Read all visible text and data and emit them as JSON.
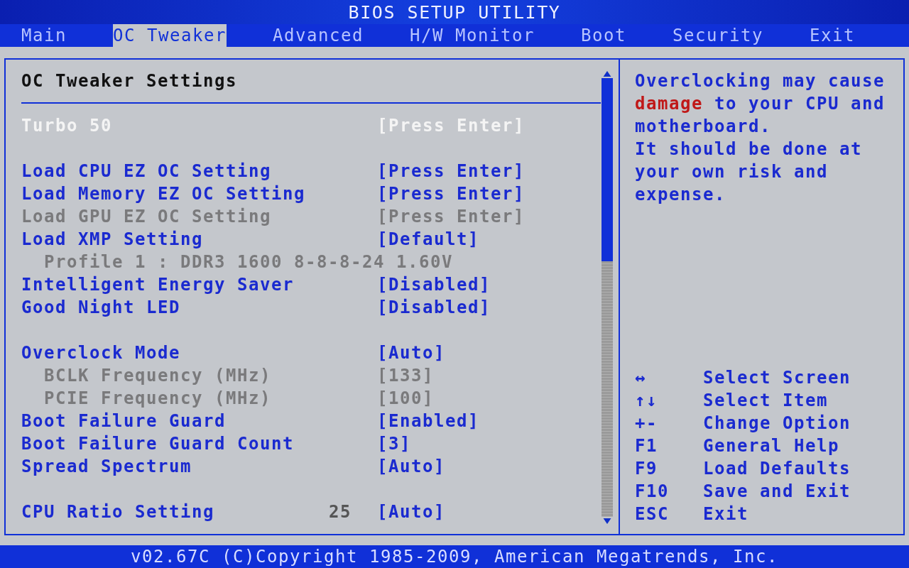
{
  "window": {
    "title": "BIOS SETUP UTILITY"
  },
  "tabs": [
    {
      "label": "Main",
      "selected": false
    },
    {
      "label": "OC Tweaker",
      "selected": true
    },
    {
      "label": "Advanced",
      "selected": false
    },
    {
      "label": "H/W Monitor",
      "selected": false
    },
    {
      "label": "Boot",
      "selected": false
    },
    {
      "label": "Security",
      "selected": false
    },
    {
      "label": "Exit",
      "selected": false
    }
  ],
  "panel_title": "OC Tweaker Settings",
  "item_groups": [
    [
      {
        "label": "Turbo 50",
        "value": "[Press Enter]",
        "selected": true,
        "disabled": false,
        "indented": false
      }
    ],
    [
      {
        "label": "Load CPU EZ OC Setting",
        "value": "[Press Enter]",
        "selected": false,
        "disabled": false,
        "indented": false
      },
      {
        "label": "Load Memory EZ OC Setting",
        "value": "[Press Enter]",
        "selected": false,
        "disabled": false,
        "indented": false
      },
      {
        "label": "Load GPU EZ OC Setting",
        "value": "[Press Enter]",
        "selected": false,
        "disabled": true,
        "indented": false
      },
      {
        "label": "Load XMP Setting",
        "value": "[Default]",
        "selected": false,
        "disabled": false,
        "indented": false
      },
      {
        "label": "Profile 1 : DDR3 1600 8-8-8-24 1.60V",
        "selected": false,
        "disabled": true,
        "indented": true
      },
      {
        "label": "Intelligent Energy Saver",
        "value": "[Disabled]",
        "selected": false,
        "disabled": false,
        "indented": false
      },
      {
        "label": "Good Night LED",
        "value": "[Disabled]",
        "selected": false,
        "disabled": false,
        "indented": false
      }
    ],
    [
      {
        "label": "Overclock Mode",
        "value": "[Auto]",
        "selected": false,
        "disabled": false,
        "indented": false
      },
      {
        "label": "BCLK Frequency (MHz)",
        "value": "[133]",
        "selected": false,
        "disabled": true,
        "indented": true
      },
      {
        "label": "PCIE Frequency (MHz)",
        "value": "[100]",
        "selected": false,
        "disabled": true,
        "indented": true
      },
      {
        "label": "Boot Failure Guard",
        "value": "[Enabled]",
        "selected": false,
        "disabled": false,
        "indented": false
      },
      {
        "label": "Boot Failure Guard Count",
        "value": "[3]",
        "selected": false,
        "disabled": false,
        "indented": false
      },
      {
        "label": "Spread Spectrum",
        "value": "[Auto]",
        "selected": false,
        "disabled": false,
        "indented": false
      }
    ],
    [
      {
        "label": "CPU Ratio Setting",
        "reading": "25",
        "value": "[Auto]",
        "selected": false,
        "disabled": false,
        "indented": false
      }
    ]
  ],
  "help": [
    [
      {
        "text": "Overclocking may cause ",
        "warning": false
      },
      {
        "text": "damage",
        "warning": true
      },
      {
        "text": " to your CPU and motherboard.",
        "warning": false
      }
    ],
    [
      {
        "text": "It should be done at your own risk and expense.",
        "warning": false
      }
    ]
  ],
  "legend": [
    {
      "key": "↔",
      "action": "Select Screen"
    },
    {
      "key": "↑↓",
      "action": "Select Item"
    },
    {
      "key": "+-",
      "action": "Change Option"
    },
    {
      "key": "F1",
      "action": "General Help"
    },
    {
      "key": "F9",
      "action": "Load Defaults"
    },
    {
      "key": "F10",
      "action": "Save and Exit"
    },
    {
      "key": "ESC",
      "action": "Exit"
    }
  ],
  "status_bar": "v02.67C (C)Copyright 1985-2009, American Megatrends, Inc."
}
